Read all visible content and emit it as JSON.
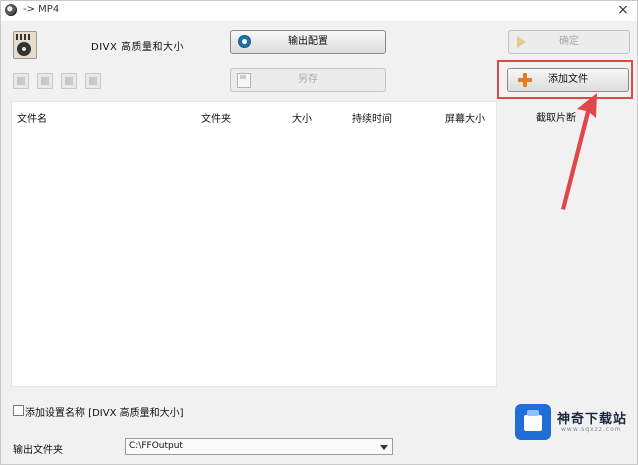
{
  "window": {
    "title": "-> MP4",
    "close_glyph": "×"
  },
  "profile": {
    "label": "DIVX 高质量和大小"
  },
  "buttons": {
    "output_config": "输出配置",
    "save": "另存",
    "ok": "确定",
    "add_files": "添加文件"
  },
  "file_list": {
    "columns": [
      "文件名",
      "文件夹",
      "大小",
      "持续时间",
      "屏幕大小",
      "截取片断"
    ]
  },
  "options": {
    "add_setting_name_label": "添加设置名称 [DIVX 高质量和大小]",
    "add_setting_name_checked": false
  },
  "output": {
    "folder_label": "输出文件夹",
    "folder_value": "C:\\FFOutput"
  },
  "watermark": {
    "name": "神奇下载站",
    "url": "www.sqxzz.com"
  },
  "colors": {
    "highlight": "#e0474b",
    "accent_orange": "#e57b22"
  }
}
